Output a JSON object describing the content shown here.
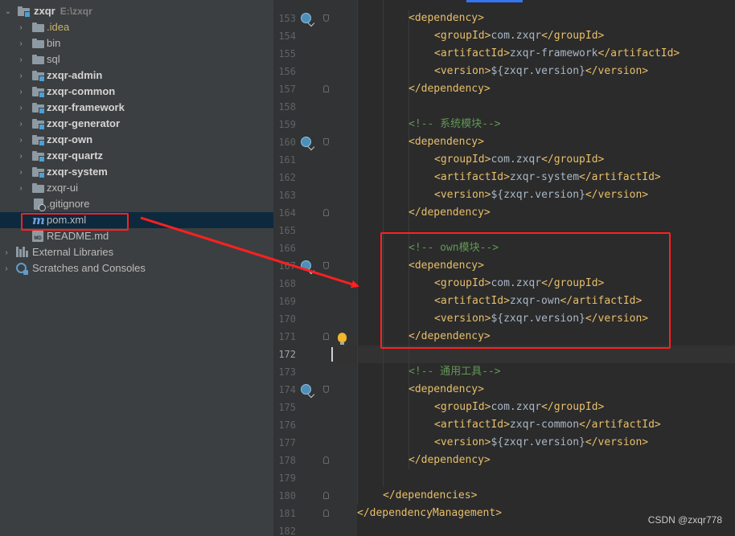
{
  "project_tree": {
    "root": {
      "name": "zxqr",
      "path": "E:\\zxqr"
    },
    "items": [
      {
        "label": ".idea",
        "kind": "folder",
        "style": "idea"
      },
      {
        "label": "bin",
        "kind": "folder"
      },
      {
        "label": "sql",
        "kind": "folder"
      },
      {
        "label": "zxqr-admin",
        "kind": "module"
      },
      {
        "label": "zxqr-common",
        "kind": "module"
      },
      {
        "label": "zxqr-framework",
        "kind": "module"
      },
      {
        "label": "zxqr-generator",
        "kind": "module"
      },
      {
        "label": "zxqr-own",
        "kind": "module"
      },
      {
        "label": "zxqr-quartz",
        "kind": "module"
      },
      {
        "label": "zxqr-system",
        "kind": "module"
      },
      {
        "label": "zxqr-ui",
        "kind": "folder"
      },
      {
        "label": ".gitignore",
        "kind": "file-ignored"
      },
      {
        "label": "pom.xml",
        "kind": "maven",
        "selected": true
      },
      {
        "label": "README.md",
        "kind": "markdown"
      }
    ],
    "external_libraries": "External Libraries",
    "scratches": "Scratches and Consoles"
  },
  "editor": {
    "current_line": "172",
    "lines": [
      {
        "num": "153",
        "indent": 2,
        "tag": "<dependency>",
        "gutter_icon": true,
        "fold": "open"
      },
      {
        "num": "154",
        "indent": 3,
        "open": "<groupId>",
        "value": "com.zxqr",
        "close": "</groupId>"
      },
      {
        "num": "155",
        "indent": 3,
        "open": "<artifactId>",
        "value": "zxqr-framework",
        "close": "</artifactId>"
      },
      {
        "num": "156",
        "indent": 3,
        "open": "<version>",
        "value": "${zxqr.version}",
        "close": "</version>"
      },
      {
        "num": "157",
        "indent": 2,
        "tag": "</dependency>",
        "fold": "close"
      },
      {
        "num": "158",
        "indent": 0
      },
      {
        "num": "159",
        "indent": 2,
        "comment": "<!-- 系统模块-->"
      },
      {
        "num": "160",
        "indent": 2,
        "tag": "<dependency>",
        "gutter_icon": true,
        "fold": "open"
      },
      {
        "num": "161",
        "indent": 3,
        "open": "<groupId>",
        "value": "com.zxqr",
        "close": "</groupId>"
      },
      {
        "num": "162",
        "indent": 3,
        "open": "<artifactId>",
        "value": "zxqr-system",
        "close": "</artifactId>"
      },
      {
        "num": "163",
        "indent": 3,
        "open": "<version>",
        "value": "${zxqr.version}",
        "close": "</version>"
      },
      {
        "num": "164",
        "indent": 2,
        "tag": "</dependency>",
        "fold": "close"
      },
      {
        "num": "165",
        "indent": 0
      },
      {
        "num": "166",
        "indent": 2,
        "comment": "<!-- own模块-->"
      },
      {
        "num": "167",
        "indent": 2,
        "tag": "<dependency>",
        "gutter_icon": true,
        "fold": "open"
      },
      {
        "num": "168",
        "indent": 3,
        "open": "<groupId>",
        "value": "com.zxqr",
        "close": "</groupId>"
      },
      {
        "num": "169",
        "indent": 3,
        "open": "<artifactId>",
        "value": "zxqr-own",
        "close": "</artifactId>"
      },
      {
        "num": "170",
        "indent": 3,
        "open": "<version>",
        "value": "${zxqr.version}",
        "close": "</version>"
      },
      {
        "num": "171",
        "indent": 2,
        "tag": "</dependency>",
        "fold": "close",
        "bulb": true
      },
      {
        "num": "172",
        "indent": 0
      },
      {
        "num": "173",
        "indent": 2,
        "comment": "<!-- 通用工具-->"
      },
      {
        "num": "174",
        "indent": 2,
        "tag": "<dependency>",
        "gutter_icon": true,
        "fold": "open"
      },
      {
        "num": "175",
        "indent": 3,
        "open": "<groupId>",
        "value": "com.zxqr",
        "close": "</groupId>"
      },
      {
        "num": "176",
        "indent": 3,
        "open": "<artifactId>",
        "value": "zxqr-common",
        "close": "</artifactId>"
      },
      {
        "num": "177",
        "indent": 3,
        "open": "<version>",
        "value": "${zxqr.version}",
        "close": "</version>"
      },
      {
        "num": "178",
        "indent": 2,
        "tag": "</dependency>",
        "fold": "close"
      },
      {
        "num": "179",
        "indent": 0
      },
      {
        "num": "180",
        "indent": 1,
        "tag": "</dependencies>",
        "fold": "close"
      },
      {
        "num": "181",
        "indent": 0,
        "tag": "</dependencyManagement>",
        "fold": "close"
      },
      {
        "num": "182",
        "indent": 0
      }
    ]
  },
  "annotations": {
    "highlight_color": "#ff2020"
  },
  "watermark": "CSDN @zxqr778",
  "colors": {
    "tag": "#e8bf6a",
    "text": "#a9b7c6",
    "comment": "#629755",
    "tree_bg": "#3c3f41",
    "editor_bg": "#2b2b2b",
    "selection": "#0d293e"
  }
}
